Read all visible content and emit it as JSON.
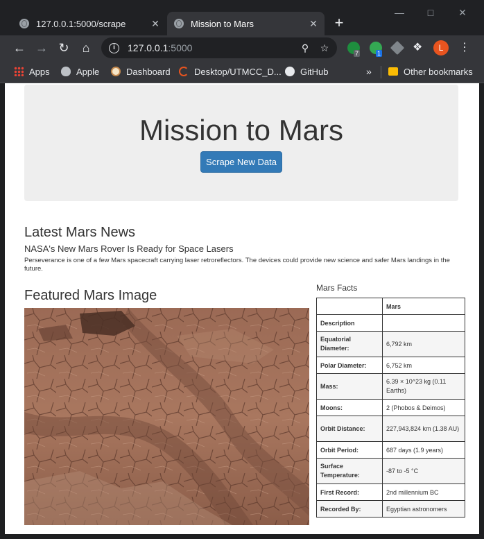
{
  "browser": {
    "tabs": [
      {
        "title": "127.0.0.1:5000/scrape",
        "active": false
      },
      {
        "title": "Mission to Mars",
        "active": true
      }
    ],
    "url_host": "127.0.0.1",
    "url_port": ":5000",
    "avatar_letter": "L",
    "bookmarks": [
      {
        "label": "Apps",
        "icon": "apps-grid-icon"
      },
      {
        "label": "Apple",
        "icon": "apple-icon"
      },
      {
        "label": "Dashboard",
        "icon": "dashboard-icon"
      },
      {
        "label": "Desktop/UTMCC_D...",
        "icon": "folder-loader-icon"
      },
      {
        "label": "GitHub",
        "icon": "github-icon"
      }
    ],
    "bookmarks_more": "»",
    "other_bookmarks": "Other bookmarks",
    "extension_badges": [
      "7",
      "1"
    ]
  },
  "page": {
    "title": "Mission to Mars",
    "scrape_button": "Scrape New Data",
    "news_heading": "Latest Mars News",
    "news_title": "NASA's New Mars Rover Is Ready for Space Lasers",
    "news_paragraph": "Perseverance is one of a few Mars spacecraft carrying laser retroreflectors. The devices could provide new science and safer Mars landings in the future.",
    "featured_heading": "Featured Mars Image",
    "facts_heading": "Mars Facts",
    "facts_table": {
      "header": [
        "",
        "Mars"
      ],
      "rows": [
        [
          "Description",
          ""
        ],
        [
          "Equatorial Diameter:",
          "6,792 km"
        ],
        [
          "Polar Diameter:",
          "6,752 km"
        ],
        [
          "Mass:",
          "6.39 × 10^23 kg (0.11 Earths)"
        ],
        [
          "Moons:",
          "2 (Phobos & Deimos)"
        ],
        [
          "Orbit Distance:",
          "227,943,824 km (1.38 AU)"
        ],
        [
          "Orbit Period:",
          "687 days (1.9 years)"
        ],
        [
          "Surface Temperature:",
          "-87 to -5 °C"
        ],
        [
          "First Record:",
          "2nd millennium BC"
        ],
        [
          "Recorded By:",
          "Egyptian astronomers"
        ]
      ]
    }
  },
  "colors": {
    "button_blue": "#337ab7",
    "jumbotron_gray": "#eeeeee",
    "chrome_dark": "#202124",
    "chrome_toolbar": "#35363a"
  }
}
